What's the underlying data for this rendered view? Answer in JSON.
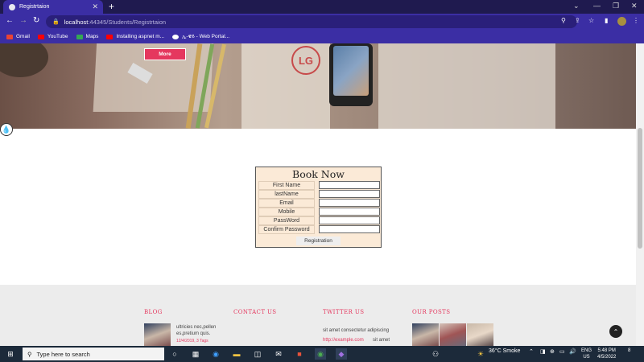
{
  "browser": {
    "tab_title": "Registrtaion",
    "url_host": "localhost",
    "url_path": ":44345/Students/Registrtaion",
    "new_tab_glyph": "+",
    "bookmarks": [
      {
        "label": "Gmail",
        "color": "#ea4335"
      },
      {
        "label": "YouTube",
        "color": "#ff0000"
      },
      {
        "label": "Maps",
        "color": "#34a853"
      },
      {
        "label": "Installing aspnet m...",
        "color": "#ff0000"
      },
      {
        "label": "ኢ-ዌይ - Web Portal...",
        "color": "#ffffff"
      }
    ]
  },
  "hero": {
    "more_label": "More",
    "logo_text": "LG"
  },
  "form": {
    "title": "Book Now",
    "fields": [
      {
        "label": "First Name"
      },
      {
        "label": "lastName"
      },
      {
        "label": "Email"
      },
      {
        "label": "Mobile"
      },
      {
        "label": "PassWord"
      },
      {
        "label": "Confirm Password"
      }
    ],
    "submit_label": "Registration"
  },
  "footer": {
    "blog_heading": "BLOG",
    "contact_heading": "CONTACT US",
    "twitter_heading": "TWITTER US",
    "posts_heading": "OUR POSTS",
    "blog_text": "ultricies nec,pellen es,pretium quis.",
    "blog_meta": "12/4/2019, 3 Tags",
    "twitter_text": "sit amet consectetur adipiscing",
    "twitter_link": "http://example.com",
    "twitter_tail": "sit amet"
  },
  "taskbar": {
    "search_placeholder": "Type here to search",
    "weather": "36°C  Smoke",
    "lang1": "ENG",
    "lang2": "US",
    "time": "5:48 PM",
    "date": "4/5/2022",
    "notifications": "8"
  }
}
